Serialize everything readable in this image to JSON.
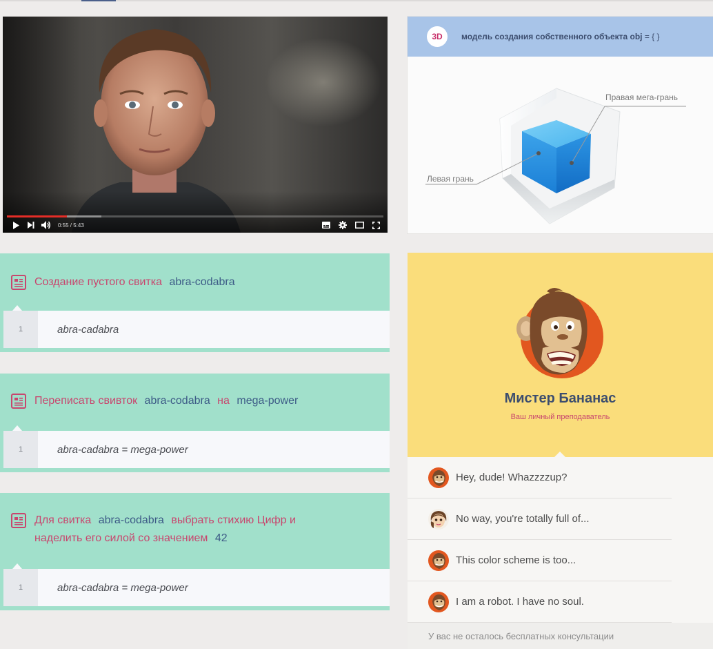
{
  "video": {
    "time_label": "0:55 / 5:43",
    "progress": 0.16,
    "buffered": 0.25,
    "accent": "#e52d27"
  },
  "card3d": {
    "badge": "3D",
    "title": "модель создания собственного объекта obj",
    "title_code": "= { }",
    "label_right": "Правая мега-грань",
    "label_left": "Левая грань"
  },
  "tasks": [
    {
      "title_parts": [
        "Создание пустого свитка",
        "abra-codabra"
      ],
      "line_no": "1",
      "code": "abra-cadabra"
    },
    {
      "title_parts": [
        "Переписать свивток",
        "abra-codabra",
        "на",
        "mega-power"
      ],
      "line_no": "1",
      "code": "abra-cadabra = mega-power"
    },
    {
      "title_parts": [
        "Для свитка",
        "abra-codabra",
        "выбрать стихию Цифр и",
        "наделить его силой со значением",
        "42"
      ],
      "line_no": "1",
      "code": "abra-cadabra = mega-power"
    }
  ],
  "tutor": {
    "name": "Мистер Бананас",
    "role": "Ваш личный преподаватель",
    "messages": [
      {
        "avatar": "monkey-avatar-icon",
        "text": "Hey, dude! Whazzzzup?"
      },
      {
        "avatar": "girl-avatar-icon",
        "text": "No way, you're totally full of..."
      },
      {
        "avatar": "monkey-avatar-icon",
        "text": "This color scheme is too..."
      },
      {
        "avatar": "monkey-avatar-icon",
        "text": "I am a robot. I have no soul."
      }
    ],
    "footer": "У вас не осталось бесплатных консультации"
  },
  "colors": {
    "mint": "#a1e0cb",
    "pink": "#c8466e",
    "navy": "#3c5a86",
    "yellow": "#fadd7b",
    "blue_header": "#a8c4e8"
  }
}
